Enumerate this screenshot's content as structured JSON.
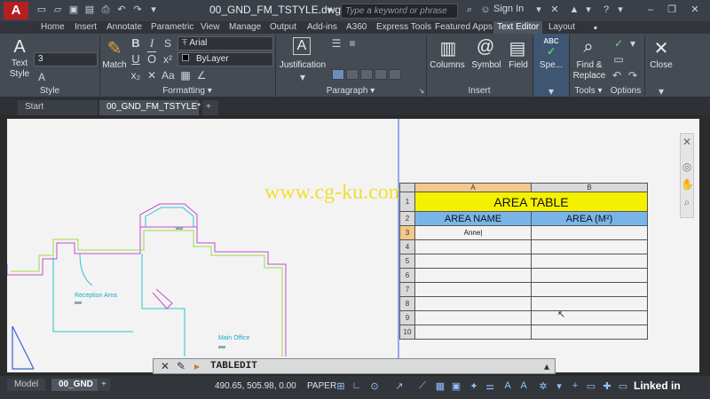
{
  "app": {
    "logo_letter": "A",
    "document_title": "00_GND_FM_TSTYLE.dwg",
    "search_placeholder": "Type a keyword or phrase",
    "sign_in": "Sign In"
  },
  "ribbon_tabs": [
    "Home",
    "Insert",
    "Annotate",
    "Parametric",
    "View",
    "Manage",
    "Output",
    "Add-ins",
    "A360",
    "Express Tools",
    "Featured Apps",
    "Text Editor",
    "Layout"
  ],
  "active_ribbon_tab": "Text Editor",
  "ribbon": {
    "style": {
      "text_style_label": "Text\nStyle",
      "height_value": "3",
      "panel_label": "Style"
    },
    "formatting": {
      "match_label": "Match",
      "font_value": "Arial",
      "color_value": "ByLayer",
      "panel_label": "Formatting ▾",
      "bold": "B",
      "italic": "I",
      "underline": "U",
      "overline": "O"
    },
    "paragraph": {
      "justification_label": "Justification",
      "panel_label": "Paragraph ▾"
    },
    "insert": {
      "columns_label": "Columns",
      "symbol_label": "Symbol",
      "field_label": "Field",
      "panel_label": "Insert"
    },
    "spell": {
      "label": "Spe..."
    },
    "tools": {
      "find_replace_label": "Find &\nReplace",
      "panel_label": "Tools ▾"
    },
    "options": {
      "panel_label": "Options"
    },
    "close": {
      "label": "Close"
    }
  },
  "doc_tabs": {
    "start": "Start",
    "current": "00_GND_FM_TSTYLE*",
    "add": "+"
  },
  "drawing": {
    "watermark": "www.cg-ku.com",
    "rooms": [
      "Reception Area",
      "Main Office"
    ]
  },
  "table": {
    "col_headers": [
      "A",
      "B"
    ],
    "title": "AREA TABLE",
    "col_titles": [
      "AREA NAME",
      "AREA (M²)"
    ],
    "row_numbers": [
      "1",
      "2",
      "3",
      "4",
      "5",
      "6",
      "7",
      "8",
      "9",
      "10"
    ],
    "editing_cell_text": "Anne|"
  },
  "command_line": {
    "text": "TABLEDIT"
  },
  "status": {
    "model_tab": "Model",
    "layout_tab": "00_GND",
    "add": "+",
    "coords": "490.65, 505.98, 0.00",
    "space": "PAPER"
  },
  "brand": "Linked in"
}
